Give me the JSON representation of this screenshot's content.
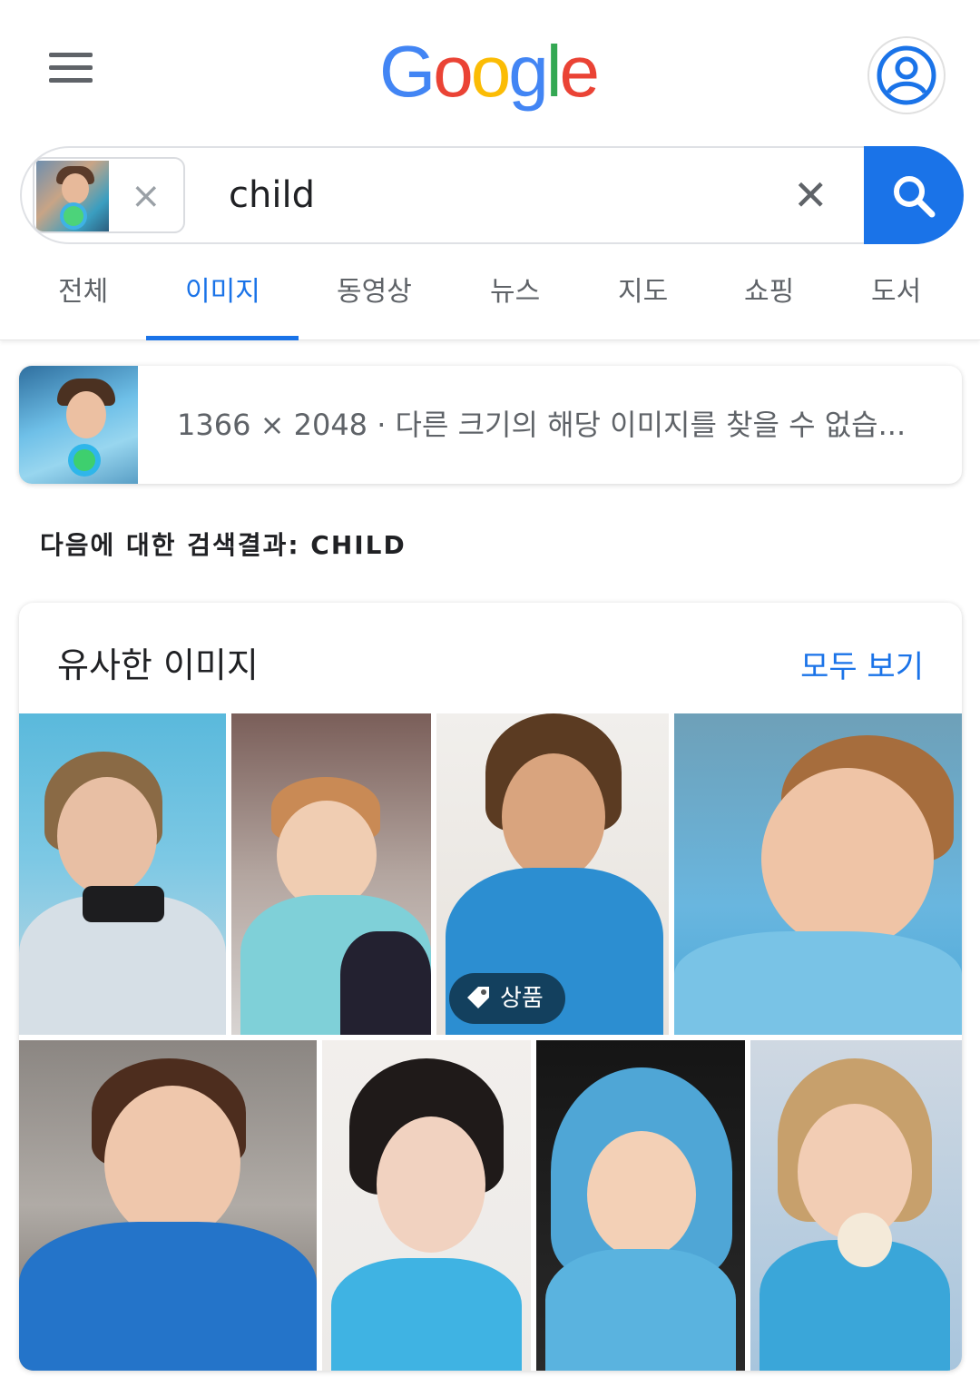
{
  "header": {
    "logo_letters": [
      {
        "char": "G",
        "color": "#4285F4"
      },
      {
        "char": "o",
        "color": "#EA4335"
      },
      {
        "char": "o",
        "color": "#FBBC05"
      },
      {
        "char": "g",
        "color": "#4285F4"
      },
      {
        "char": "l",
        "color": "#34A853"
      },
      {
        "char": "e",
        "color": "#EA4335"
      }
    ],
    "menu_icon": "hamburger-menu-icon",
    "account_icon": "account-circle-icon"
  },
  "search": {
    "query": "child",
    "chip_remove": "×",
    "clear": "✕",
    "button_icon": "search-icon"
  },
  "tabs": [
    {
      "label": "전체"
    },
    {
      "label": "이미지"
    },
    {
      "label": "동영상"
    },
    {
      "label": "뉴스"
    },
    {
      "label": "지도"
    },
    {
      "label": "쇼핑"
    },
    {
      "label": "도서"
    }
  ],
  "active_tab": "이미지",
  "info_card": {
    "text": "1366 × 2048 · 다른 크기의 해당 이미지를 찾을 수 없습..."
  },
  "results_for": "다음에 대한 검색결과: CHILD",
  "similar": {
    "title": "유사한 이미지",
    "view_all": "모두 보기",
    "product_badge": "상품",
    "tag_icon": "tag-icon"
  },
  "colors": {
    "accent": "#1a73e8",
    "text_secondary": "#5f6368",
    "text_primary": "#202124"
  }
}
